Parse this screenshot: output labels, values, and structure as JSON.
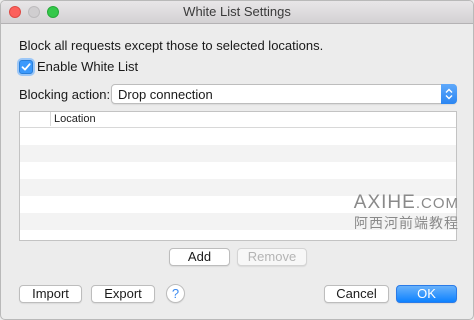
{
  "window": {
    "title": "White List Settings"
  },
  "description": "Block all requests except those to selected locations.",
  "enable_checkbox": {
    "label": "Enable White List",
    "checked": true
  },
  "blocking": {
    "label": "Blocking action:",
    "selected": "Drop connection"
  },
  "table": {
    "columns": [
      "",
      "Location"
    ],
    "rows": []
  },
  "watermark": {
    "line1_main": "AXIHE",
    "line1_suffix": ".COM",
    "line2": "阿西河前端教程"
  },
  "buttons": {
    "add": "Add",
    "remove": "Remove",
    "import": "Import",
    "export": "Export",
    "help": "?",
    "cancel": "Cancel",
    "ok": "OK"
  },
  "colors": {
    "accent": "#2b86f2",
    "close": "#fc605c",
    "maximize": "#34c84a"
  }
}
